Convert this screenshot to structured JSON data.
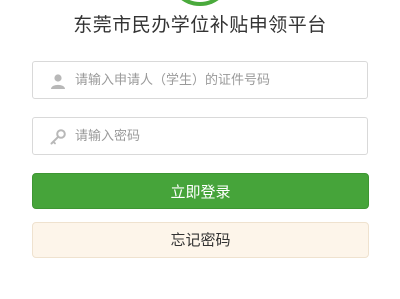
{
  "header": {
    "title": "东莞市民办学位补贴申领平台"
  },
  "form": {
    "id_field": {
      "placeholder": "请输入申请人（学生）的证件号码",
      "value": "",
      "icon": "user-icon"
    },
    "password_field": {
      "placeholder": "请输入密码",
      "value": "",
      "icon": "key-icon"
    },
    "login_label": "立即登录",
    "forgot_label": "忘记密码"
  },
  "colors": {
    "accent": "#46a43a",
    "forgot_bg": "#fdf5ea",
    "icon": "#b8b8b8"
  }
}
